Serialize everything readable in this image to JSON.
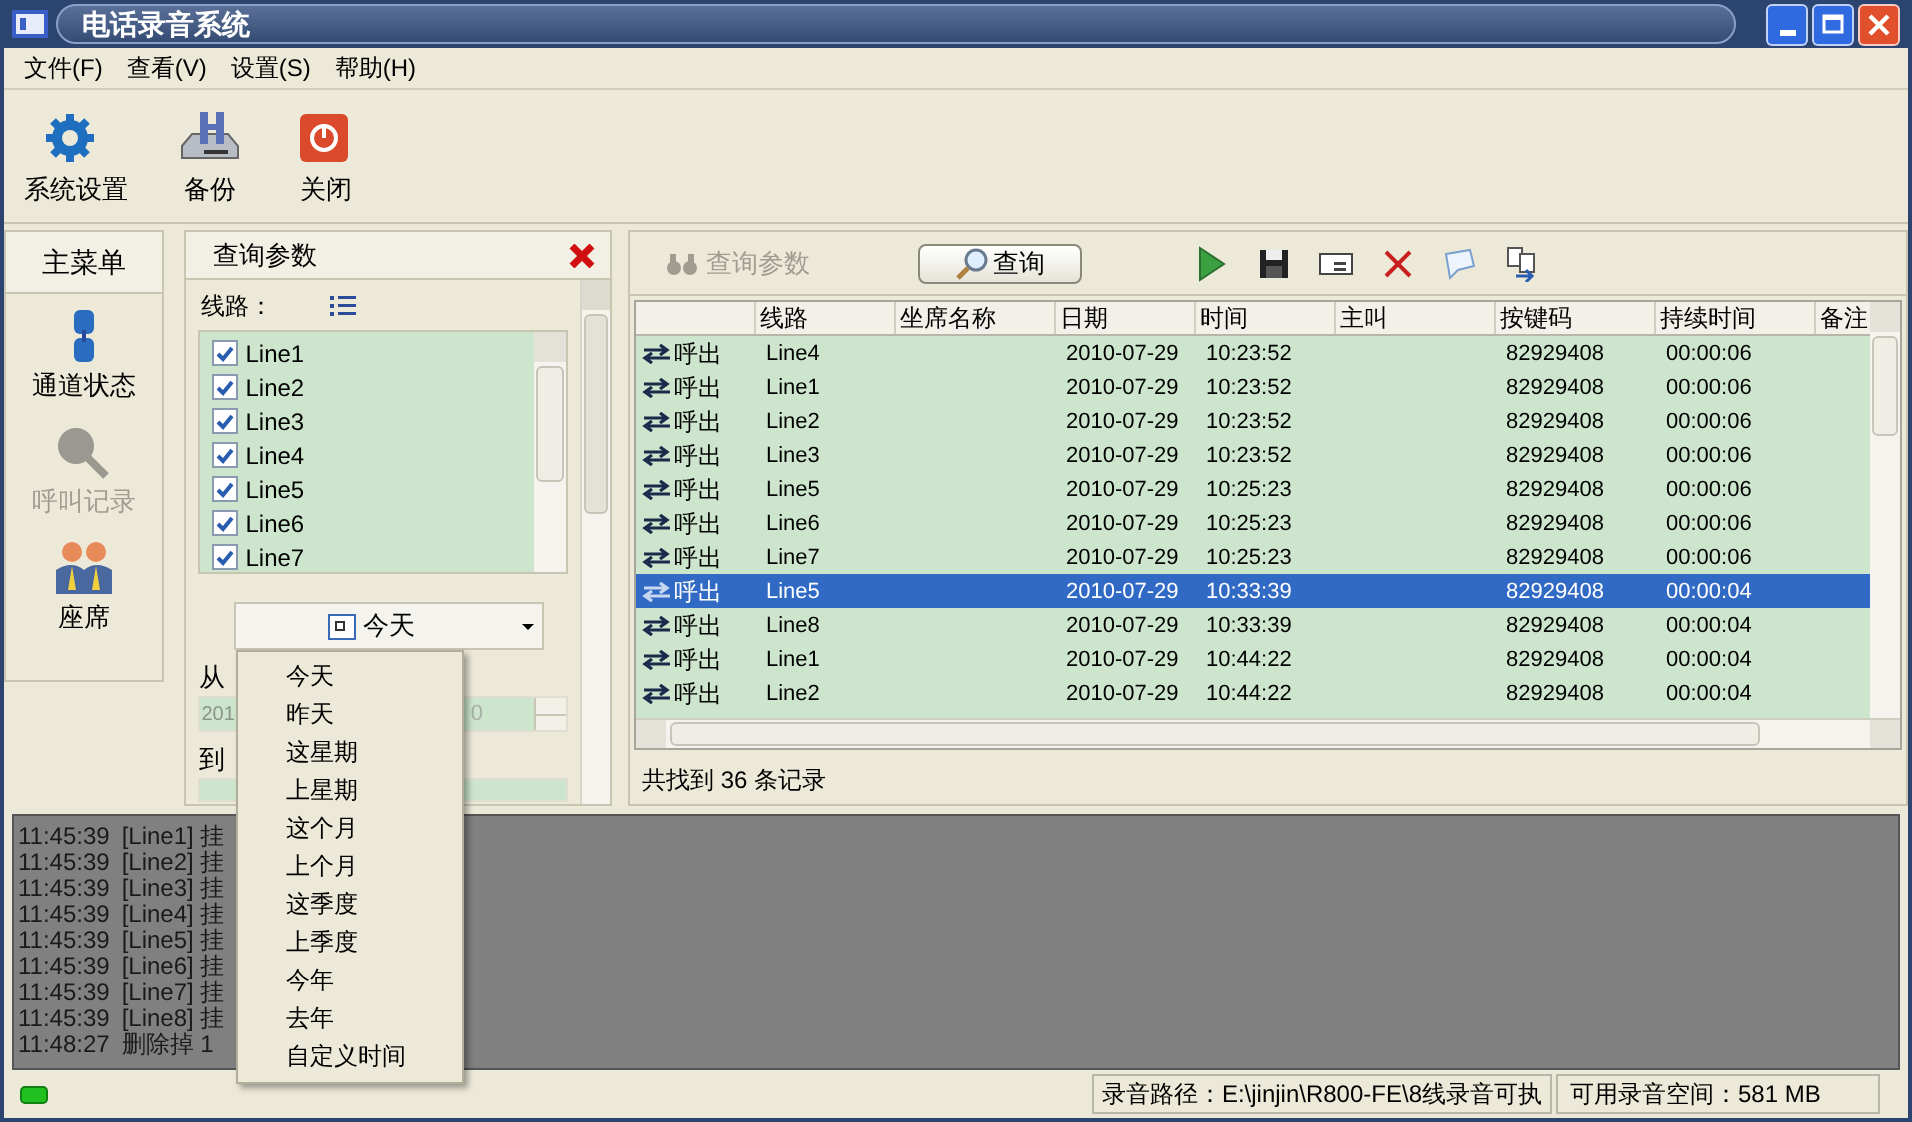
{
  "window": {
    "title": "电话录音系统"
  },
  "menu": [
    "文件(F)",
    "查看(V)",
    "设置(S)",
    "帮助(H)"
  ],
  "toolbar": [
    {
      "kind": "gear",
      "label": "系统设置"
    },
    {
      "kind": "backup",
      "label": "备份"
    },
    {
      "kind": "power",
      "label": "关闭"
    }
  ],
  "nav": {
    "header": "主菜单",
    "items": [
      {
        "kind": "channel",
        "label": "通道状态",
        "disabled": false
      },
      {
        "kind": "search",
        "label": "呼叫记录",
        "disabled": true
      },
      {
        "kind": "agents",
        "label": "座席",
        "disabled": false
      }
    ]
  },
  "query_panel": {
    "title": "查询参数",
    "line_label": "线路：",
    "lines": [
      {
        "label": "Line1",
        "checked": true
      },
      {
        "label": "Line2",
        "checked": true
      },
      {
        "label": "Line3",
        "checked": true
      },
      {
        "label": "Line4",
        "checked": true
      },
      {
        "label": "Line5",
        "checked": true
      },
      {
        "label": "Line6",
        "checked": true
      },
      {
        "label": "Line7",
        "checked": true
      }
    ],
    "period": "今天",
    "from_label": "从",
    "from_value": "201",
    "from_value_end": "0",
    "to_label": "到"
  },
  "period_menu": [
    "今天",
    "昨天",
    "这星期",
    "上星期",
    "这个月",
    "上个月",
    "这季度",
    "上季度",
    "今年",
    "去年",
    "自定义时间"
  ],
  "results": {
    "params_button": "查询参数",
    "query_button": "查询",
    "columns": [
      "线路",
      "坐席名称",
      "日期",
      "时间",
      "主叫",
      "按键码",
      "持续时间",
      "备注"
    ],
    "rows": [
      {
        "direction": "呼出",
        "line": "Line4",
        "date": "2010-07-29",
        "time": "10:23:52",
        "keycode": "82929408",
        "duration": "00:00:06",
        "selected": false
      },
      {
        "direction": "呼出",
        "line": "Line1",
        "date": "2010-07-29",
        "time": "10:23:52",
        "keycode": "82929408",
        "duration": "00:00:06",
        "selected": false
      },
      {
        "direction": "呼出",
        "line": "Line2",
        "date": "2010-07-29",
        "time": "10:23:52",
        "keycode": "82929408",
        "duration": "00:00:06",
        "selected": false
      },
      {
        "direction": "呼出",
        "line": "Line3",
        "date": "2010-07-29",
        "time": "10:23:52",
        "keycode": "82929408",
        "duration": "00:00:06",
        "selected": false
      },
      {
        "direction": "呼出",
        "line": "Line5",
        "date": "2010-07-29",
        "time": "10:25:23",
        "keycode": "82929408",
        "duration": "00:00:06",
        "selected": false
      },
      {
        "direction": "呼出",
        "line": "Line6",
        "date": "2010-07-29",
        "time": "10:25:23",
        "keycode": "82929408",
        "duration": "00:00:06",
        "selected": false
      },
      {
        "direction": "呼出",
        "line": "Line7",
        "date": "2010-07-29",
        "time": "10:25:23",
        "keycode": "82929408",
        "duration": "00:00:06",
        "selected": false
      },
      {
        "direction": "呼出",
        "line": "Line5",
        "date": "2010-07-29",
        "time": "10:33:39",
        "keycode": "82929408",
        "duration": "00:00:04",
        "selected": true
      },
      {
        "direction": "呼出",
        "line": "Line8",
        "date": "2010-07-29",
        "time": "10:33:39",
        "keycode": "82929408",
        "duration": "00:00:04",
        "selected": false
      },
      {
        "direction": "呼出",
        "line": "Line1",
        "date": "2010-07-29",
        "time": "10:44:22",
        "keycode": "82929408",
        "duration": "00:00:04",
        "selected": false
      },
      {
        "direction": "呼出",
        "line": "Line2",
        "date": "2010-07-29",
        "time": "10:44:22",
        "keycode": "82929408",
        "duration": "00:00:04",
        "selected": false
      }
    ],
    "found": "共找到 36 条记录"
  },
  "log": [
    {
      "time": "11:45:39",
      "text": "[Line1] 挂"
    },
    {
      "time": "11:45:39",
      "text": "[Line2] 挂"
    },
    {
      "time": "11:45:39",
      "text": "[Line3] 挂"
    },
    {
      "time": "11:45:39",
      "text": "[Line4] 挂"
    },
    {
      "time": "11:45:39",
      "text": "[Line5] 挂"
    },
    {
      "time": "11:45:39",
      "text": "[Line6] 挂"
    },
    {
      "time": "11:45:39",
      "text": "[Line7] 挂"
    },
    {
      "time": "11:45:39",
      "text": "[Line8] 挂"
    },
    {
      "time": "11:48:27",
      "text": "删除掉 1"
    }
  ],
  "status_bar": {
    "path": "录音路径：E:\\jinjin\\R800-FE\\8线录音可执",
    "space": "可用录音空间：581 MB"
  }
}
